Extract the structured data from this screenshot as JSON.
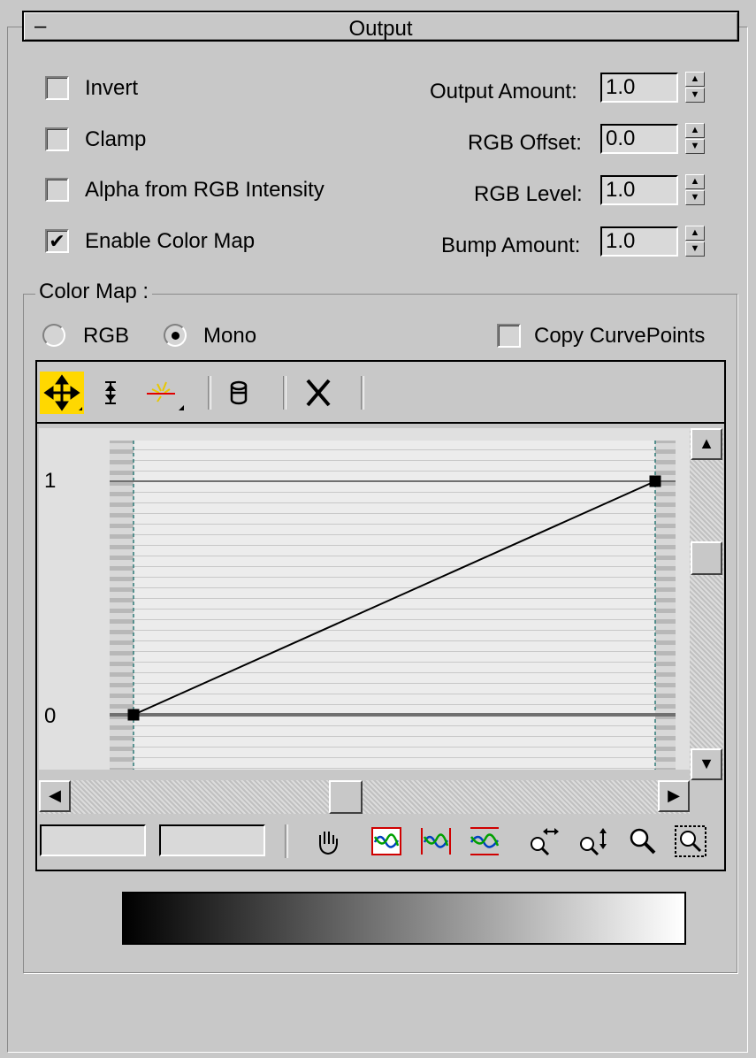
{
  "rollout": {
    "collapse_symbol": "–",
    "title": "Output"
  },
  "checkboxes": [
    {
      "label": "Invert",
      "checked": false
    },
    {
      "label": "Clamp",
      "checked": false
    },
    {
      "label": "Alpha from RGB Intensity",
      "checked": false
    },
    {
      "label": "Enable Color Map",
      "checked": true
    }
  ],
  "check_mark": "✔",
  "spinners": [
    {
      "label": "Output Amount:",
      "value": "1.0"
    },
    {
      "label": "RGB Offset:",
      "value": "0.0"
    },
    {
      "label": "RGB Level:",
      "value": "1.0"
    },
    {
      "label": "Bump Amount:",
      "value": "1.0"
    }
  ],
  "color_map": {
    "group_title": "Color Map :",
    "radio_rgb": "RGB",
    "radio_mono": "Mono",
    "selected": "Mono",
    "copy_curve_points": "Copy CurvePoints",
    "y_label_top": "1",
    "y_label_bottom": "0",
    "curve_points": [
      [
        0,
        0
      ],
      [
        1,
        1
      ]
    ],
    "gradient": {
      "from": "#000000",
      "to": "#ffffff"
    }
  },
  "toolbar": {
    "move_icon": "move-icon",
    "scale_icon": "scale-point-icon",
    "insert_icon": "insert-point-icon",
    "reset_icon": "reset-curves-icon",
    "delete_icon": "delete-point-icon",
    "active_color": "#ffd800"
  },
  "bottom_tools": [
    "pan-icon",
    "zoom-extents-icon",
    "zoom-horizontal-extents-icon",
    "zoom-value-extents-icon",
    "zoom-horizontal-icon",
    "zoom-vertical-icon",
    "zoom-icon",
    "zoom-region-icon"
  ]
}
